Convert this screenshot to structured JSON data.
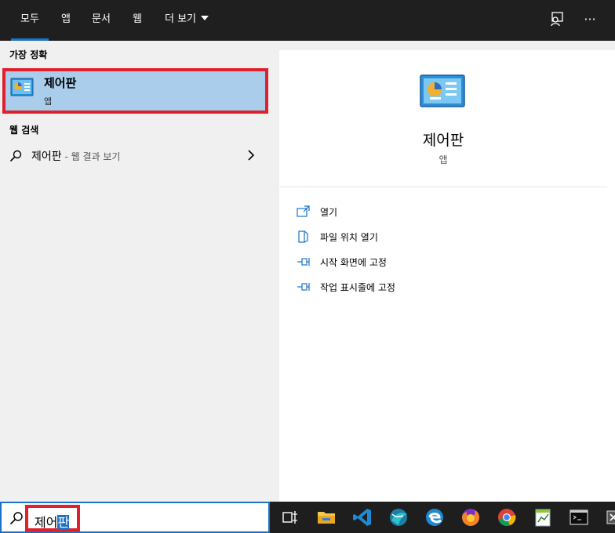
{
  "topbar": {
    "tabs": [
      {
        "label": "모두",
        "active": true
      },
      {
        "label": "앱"
      },
      {
        "label": "문서"
      },
      {
        "label": "웹"
      },
      {
        "label": "더 보기"
      }
    ],
    "icons": [
      "feedback-icon",
      "more-options-icon"
    ],
    "more_glyph": "···"
  },
  "left": {
    "best_match_header": "가장 정확",
    "best_match": {
      "title": "제어판",
      "subtitle": "앱",
      "icon": "control-panel-icon"
    },
    "web_header": "웹 검색",
    "web_result": {
      "text": "제어판",
      "suffix": " - 웹 결과 보기"
    }
  },
  "right": {
    "title": "제어판",
    "subtitle": "앱",
    "actions": [
      {
        "label": "열기",
        "icon": "open-icon"
      },
      {
        "label": "파일 위치 열기",
        "icon": "file-location-icon"
      },
      {
        "label": "시작 화면에 고정",
        "icon": "pin-start-icon"
      },
      {
        "label": "작업 표시줄에 고정",
        "icon": "pin-taskbar-icon"
      }
    ]
  },
  "search": {
    "typed": "제어",
    "selected": "판"
  },
  "taskbar": {
    "items": [
      "task-view-icon",
      "file-explorer-icon",
      "vscode-icon",
      "app-icon",
      "edge-icon",
      "firefox-icon",
      "chrome-icon",
      "notepad-icon",
      "terminal-icon",
      "overflow-icon"
    ]
  },
  "colors": {
    "accent": "#1a73c8",
    "highlight": "#a9cdeb",
    "annotation": "#e0202c",
    "topbar": "#1f1f1f",
    "taskbar": "#1e1e1e"
  }
}
